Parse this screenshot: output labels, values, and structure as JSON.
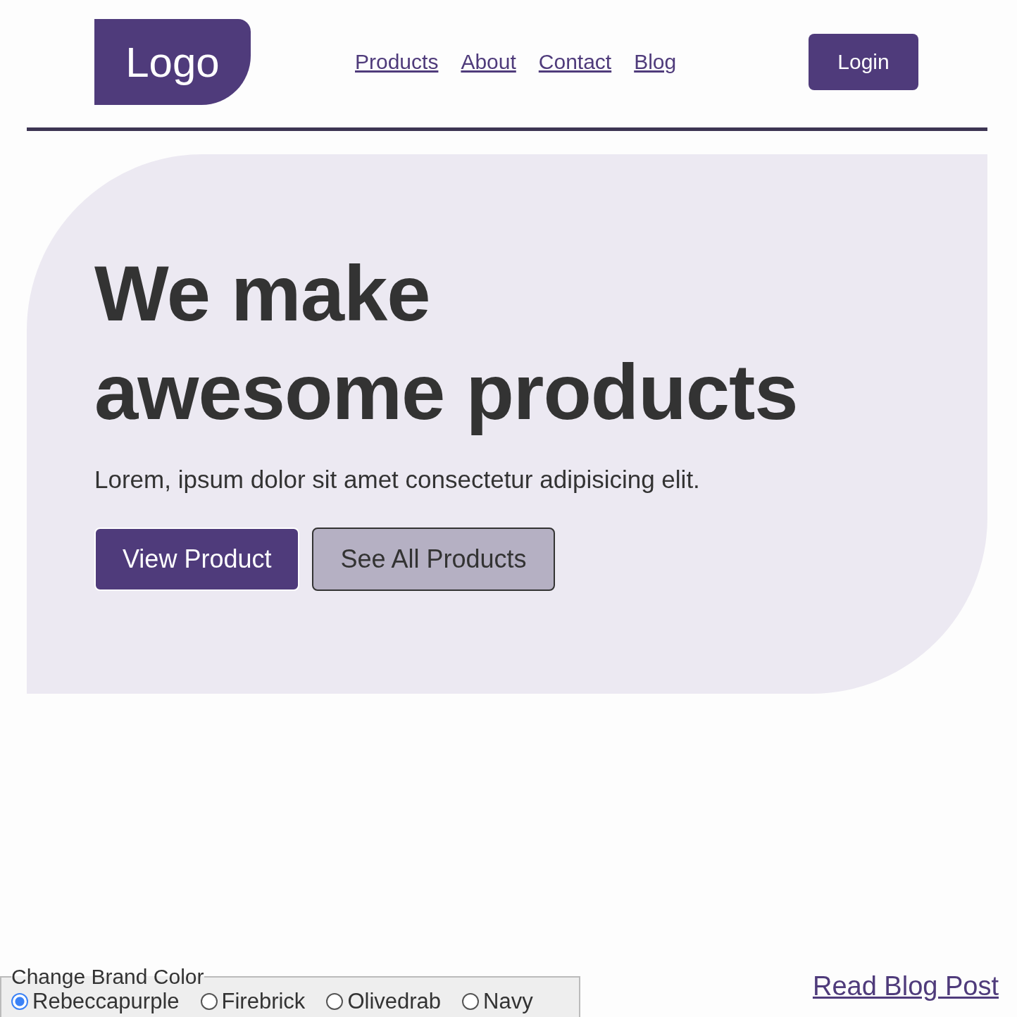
{
  "header": {
    "logo": "Logo",
    "nav": [
      {
        "label": "Products"
      },
      {
        "label": "About"
      },
      {
        "label": "Contact"
      },
      {
        "label": "Blog"
      }
    ],
    "login": "Login"
  },
  "hero": {
    "heading_lines": [
      "We make",
      "awesome products"
    ],
    "text": "Lorem, ipsum dolor sit amet consectetur adipisicing elit.",
    "buttons": [
      {
        "label": "View Product",
        "kind": "primary"
      },
      {
        "label": "See All Products",
        "kind": "secondary"
      }
    ]
  },
  "brand_color": {
    "legend": "Change Brand Color",
    "options": [
      {
        "label": "Rebeccapurple",
        "selected": true
      },
      {
        "label": "Firebrick",
        "selected": false
      },
      {
        "label": "Olivedrab",
        "selected": false
      },
      {
        "label": "Navy",
        "selected": false
      }
    ]
  },
  "blog_link": "Read Blog Post"
}
